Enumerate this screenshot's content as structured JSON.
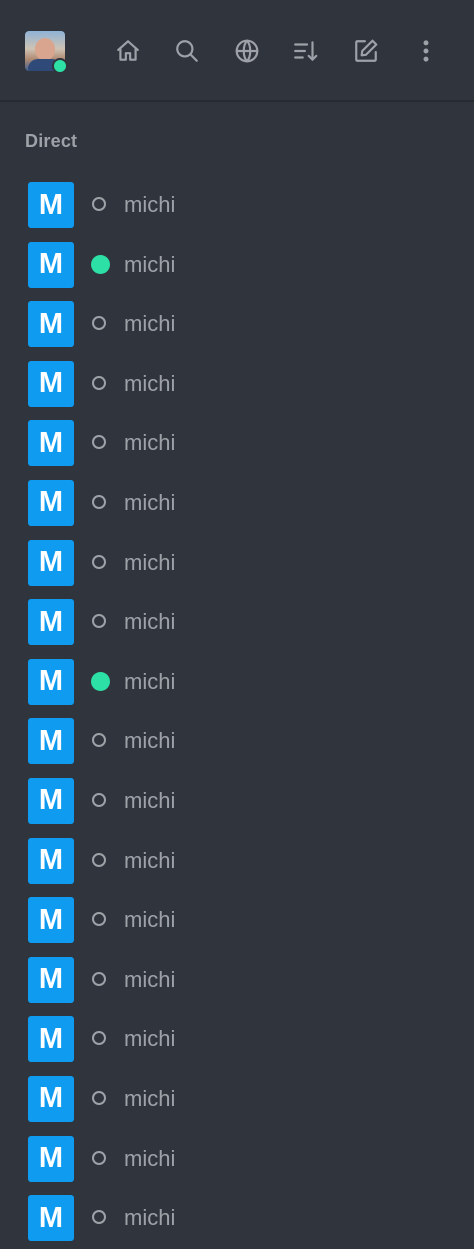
{
  "header": {
    "icons": [
      {
        "name": "home-icon"
      },
      {
        "name": "search-icon"
      },
      {
        "name": "globe-icon"
      },
      {
        "name": "sort-icon"
      },
      {
        "name": "edit-icon"
      },
      {
        "name": "kebab-menu-icon"
      }
    ],
    "user_status": "online"
  },
  "direct": {
    "title": "Direct",
    "items": [
      {
        "initial": "M",
        "name": "michi",
        "status": "offline"
      },
      {
        "initial": "M",
        "name": "michi",
        "status": "online"
      },
      {
        "initial": "M",
        "name": "michi",
        "status": "offline"
      },
      {
        "initial": "M",
        "name": "michi",
        "status": "offline"
      },
      {
        "initial": "M",
        "name": "michi",
        "status": "offline"
      },
      {
        "initial": "M",
        "name": "michi",
        "status": "offline"
      },
      {
        "initial": "M",
        "name": "michi",
        "status": "offline"
      },
      {
        "initial": "M",
        "name": "michi",
        "status": "offline"
      },
      {
        "initial": "M",
        "name": "michi",
        "status": "online"
      },
      {
        "initial": "M",
        "name": "michi",
        "status": "offline"
      },
      {
        "initial": "M",
        "name": "michi",
        "status": "offline"
      },
      {
        "initial": "M",
        "name": "michi",
        "status": "offline"
      },
      {
        "initial": "M",
        "name": "michi",
        "status": "offline"
      },
      {
        "initial": "M",
        "name": "michi",
        "status": "offline"
      },
      {
        "initial": "M",
        "name": "michi",
        "status": "offline"
      },
      {
        "initial": "M",
        "name": "michi",
        "status": "offline"
      },
      {
        "initial": "M",
        "name": "michi",
        "status": "offline"
      },
      {
        "initial": "M",
        "name": "michi",
        "status": "offline"
      }
    ]
  },
  "colors": {
    "background": "#2f343d",
    "avatar_blue": "#0f9bf0",
    "online_green": "#2de0a5",
    "text_gray": "#9ea2a8"
  }
}
